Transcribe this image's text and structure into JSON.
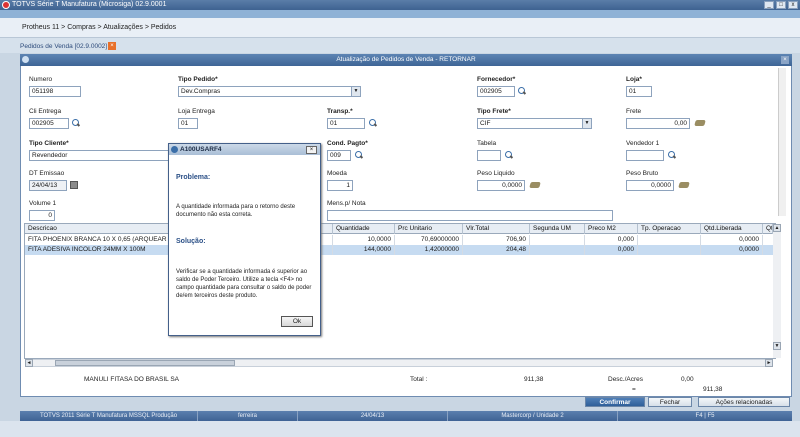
{
  "app": {
    "title": "TOTVS Série T Manufatura (Microsiga) 02.9.0001"
  },
  "breadcrumb": "Protheus 11 > Compras > Atualizações > Pedidos",
  "tab": {
    "label": "Pedidos de Venda [02.9.0002]"
  },
  "form": {
    "title": "Atualização de Pedidos de Venda - RETORNAR",
    "numero": {
      "label": "Numero",
      "value": "051198"
    },
    "tipo_pedido": {
      "label": "Tipo Pedido*",
      "value": "Dev.Compras"
    },
    "fornecedor": {
      "label": "Fornecedor*",
      "value": "002905"
    },
    "loja": {
      "label": "Loja*",
      "value": "01"
    },
    "cli_entrega": {
      "label": "Cli Entrega",
      "value": "002905"
    },
    "loja_entrega": {
      "label": "Loja Entrega",
      "value": "01"
    },
    "transp": {
      "label": "Transp.*",
      "value": "01"
    },
    "tipo_frete": {
      "label": "Tipo Frete*",
      "value": "CIF"
    },
    "frete": {
      "label": "Frete",
      "value": "0,00"
    },
    "tipo_cliente": {
      "label": "Tipo Cliente*",
      "value": "Revendedor"
    },
    "cond_pagto": {
      "label": "Cond. Pagto*",
      "value": "009"
    },
    "tabela": {
      "label": "Tabela",
      "value": ""
    },
    "vendedor1": {
      "label": "Vendedor 1",
      "value": ""
    },
    "dt_emissao": {
      "label": "DT Emissao",
      "value": "24/04/13"
    },
    "moeda": {
      "label": "Moeda",
      "value": "1"
    },
    "peso_liquido": {
      "label": "Peso Liquido",
      "value": "0,0000"
    },
    "peso_bruto": {
      "label": "Peso Bruto",
      "value": "0,0000"
    },
    "volume1": {
      "label": "Volume 1",
      "value": "0"
    },
    "mens_nota": {
      "label": "Mens.p/ Nota",
      "value": ""
    }
  },
  "grid": {
    "columns": [
      "Descricao",
      "Quantidade",
      "Prc Unitario",
      "Vlr.Total",
      "Segunda UM",
      "Preco M2",
      "Tp. Operacao",
      "Qtd.Liberada",
      "Qt"
    ],
    "rows": [
      [
        "FITA PHOENIX BRANCA 10 X 0,65 (ARQUEAR C",
        "10,0000",
        "70,69000000",
        "706,90",
        "",
        "0,000",
        "",
        "0,0000"
      ],
      [
        "FITA ADESIVA INCOLOR 24MM X 100M",
        "144,0000",
        "1,42000000",
        "204,48",
        "",
        "0,000",
        "",
        "0,0000"
      ]
    ]
  },
  "footer": {
    "cliente": "MANULI FITASA DO BRASIL SA",
    "total_label": "Total :",
    "total_value": "911,38",
    "desc_label": "Desc./Acres",
    "desc_value": "0,00",
    "eq": "=",
    "final_value": "911,38",
    "confirmar": "Confirmar",
    "fechar": "Fechar",
    "acoes": "Ações relacionadas"
  },
  "statusbar": [
    "TOTVS 2011 Série T Manufatura MSSQL Produção",
    "ferreira",
    "24/04/13",
    "Mastercorp / Unidade 2",
    "F4 | F5"
  ],
  "dialog": {
    "title": "A100USARF4",
    "problema_title": "Problema:",
    "problema_text": "A quantidade informada para o retorno deste documento não esta correta.",
    "solucao_title": "Solução:",
    "solucao_text": "Verificar se a quantidade informada é superior ao saldo de Poder Terceiro. Utilize a tecla <F4> no campo quantidade para consultar o saldo de poder de/em terceiros deste produto.",
    "ok": "Ok"
  },
  "icons": [
    "app-logo-icon",
    "lookup-icon",
    "calculator-icon",
    "calendar-icon",
    "info-icon",
    "close-icon"
  ]
}
